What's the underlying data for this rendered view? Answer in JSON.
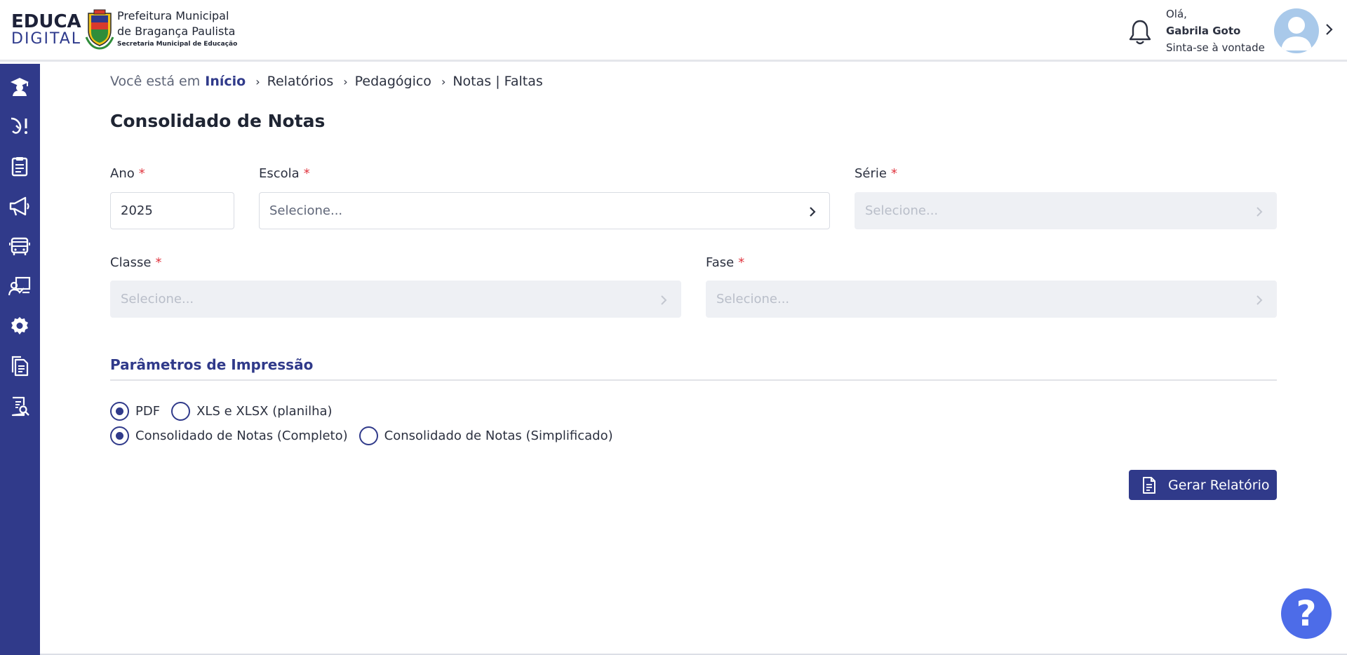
{
  "header": {
    "logo_line1": "EDUCA",
    "logo_line2": "DIGITAL",
    "org_line1": "Prefeitura Municipal",
    "org_line2": "de Bragança Paulista",
    "org_line3": "Secretaria Municipal de Educação",
    "greeting": "Olá,",
    "user_name": "Gabrila Goto",
    "welcome": "Sinta-se à vontade"
  },
  "sidebar": {
    "icons": [
      "graduate-icon",
      "hand-alert-icon",
      "clipboard-icon",
      "megaphone-icon",
      "bus-icon",
      "teacher-board-icon",
      "gear-icon",
      "documents-icon",
      "report-search-icon"
    ]
  },
  "breadcrumb": {
    "prefix": "Você está em",
    "items": [
      "Início",
      "Relatórios",
      "Pedagógico",
      "Notas | Faltas"
    ]
  },
  "page": {
    "title": "Consolidado de Notas"
  },
  "form": {
    "ano": {
      "label": "Ano",
      "required": "*",
      "value": "2025"
    },
    "escola": {
      "label": "Escola",
      "required": "*",
      "placeholder": "Selecione..."
    },
    "serie": {
      "label": "Série",
      "required": "*",
      "placeholder": "Selecione..."
    },
    "classe": {
      "label": "Classe",
      "required": "*",
      "placeholder": "Selecione..."
    },
    "fase": {
      "label": "Fase",
      "required": "*",
      "placeholder": "Selecione..."
    }
  },
  "print_params": {
    "title": "Parâmetros de Impressão",
    "format_options": [
      {
        "label": "PDF",
        "selected": true
      },
      {
        "label": "XLS e XLSX (planilha)",
        "selected": false
      }
    ],
    "type_options": [
      {
        "label": "Consolidado de Notas (Completo)",
        "selected": true
      },
      {
        "label": "Consolidado de Notas (Simplificado)",
        "selected": false
      }
    ]
  },
  "actions": {
    "generate_label": "Gerar Relatório"
  },
  "help": {
    "label": "?"
  },
  "colors": {
    "primary": "#303a8a",
    "required": "#e0353f",
    "help": "#4d6ce8",
    "disabled_field": "#eef0f4"
  }
}
